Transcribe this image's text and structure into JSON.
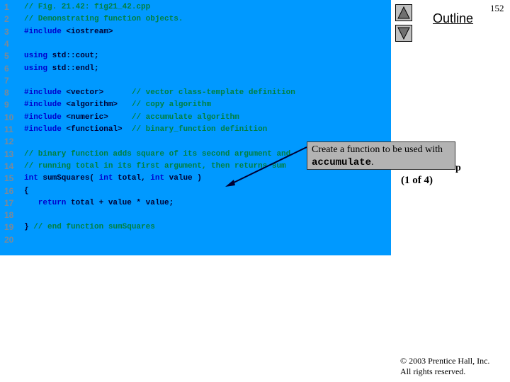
{
  "page_number": "152",
  "outline_label": "Outline",
  "navigation": {
    "up_icon": "triangle-up",
    "down_icon": "triangle-down"
  },
  "side_panel": {
    "filename_fragment": "p",
    "part": "(1 of 4)"
  },
  "code": {
    "lines": [
      {
        "n": "1",
        "segments": [
          {
            "t": "// Fig. 21.42: fig21_42.cpp",
            "c": "cm"
          }
        ]
      },
      {
        "n": "2",
        "segments": [
          {
            "t": "// Demonstrating function objects.",
            "c": "cm"
          }
        ]
      },
      {
        "n": "3",
        "segments": [
          {
            "t": "#include ",
            "c": "kw"
          },
          {
            "t": "<iostream>",
            "c": "tx"
          }
        ]
      },
      {
        "n": "4",
        "segments": []
      },
      {
        "n": "5",
        "segments": [
          {
            "t": "using ",
            "c": "kw"
          },
          {
            "t": "std::cout;",
            "c": "tx"
          }
        ]
      },
      {
        "n": "6",
        "segments": [
          {
            "t": "using ",
            "c": "kw"
          },
          {
            "t": "std::endl;",
            "c": "tx"
          }
        ]
      },
      {
        "n": "7",
        "segments": []
      },
      {
        "n": "8",
        "segments": [
          {
            "t": "#include ",
            "c": "kw"
          },
          {
            "t": "<vector>      ",
            "c": "tx"
          },
          {
            "t": "// vector class-template definition",
            "c": "cm"
          }
        ]
      },
      {
        "n": "9",
        "segments": [
          {
            "t": "#include ",
            "c": "kw"
          },
          {
            "t": "<algorithm>   ",
            "c": "tx"
          },
          {
            "t": "// copy algorithm",
            "c": "cm"
          }
        ]
      },
      {
        "n": "10",
        "segments": [
          {
            "t": "#include ",
            "c": "kw"
          },
          {
            "t": "<numeric>     ",
            "c": "tx"
          },
          {
            "t": "// accumulate algorithm",
            "c": "cm"
          }
        ]
      },
      {
        "n": "11",
        "segments": [
          {
            "t": "#include ",
            "c": "kw"
          },
          {
            "t": "<functional>  ",
            "c": "tx"
          },
          {
            "t": "// binary_function definition",
            "c": "cm"
          }
        ]
      },
      {
        "n": "12",
        "segments": []
      },
      {
        "n": "13",
        "segments": [
          {
            "t": "// binary function adds square of its second argument and",
            "c": "cm"
          }
        ]
      },
      {
        "n": "14",
        "segments": [
          {
            "t": "// running total in its first argument, then returns sum",
            "c": "cm"
          }
        ]
      },
      {
        "n": "15",
        "segments": [
          {
            "t": "int ",
            "c": "kw"
          },
          {
            "t": "sumSquares( ",
            "c": "tx"
          },
          {
            "t": "int ",
            "c": "kw"
          },
          {
            "t": "total, ",
            "c": "tx"
          },
          {
            "t": "int ",
            "c": "kw"
          },
          {
            "t": "value )",
            "c": "tx"
          }
        ]
      },
      {
        "n": "16",
        "segments": [
          {
            "t": "{",
            "c": "tx"
          }
        ]
      },
      {
        "n": "17",
        "segments": [
          {
            "t": "   return ",
            "c": "kw"
          },
          {
            "t": "total + value * value;",
            "c": "tx"
          }
        ]
      },
      {
        "n": "18",
        "segments": []
      },
      {
        "n": "19",
        "segments": [
          {
            "t": "} ",
            "c": "tx"
          },
          {
            "t": "// end function sumSquares",
            "c": "cm"
          }
        ]
      },
      {
        "n": "20",
        "segments": []
      }
    ]
  },
  "callout": {
    "text_before": "Create a function to be used with ",
    "code_word": "accumulate",
    "text_after": "."
  },
  "copyright": {
    "line1": "© 2003 Prentice Hall, Inc.",
    "line2": "All rights reserved."
  }
}
